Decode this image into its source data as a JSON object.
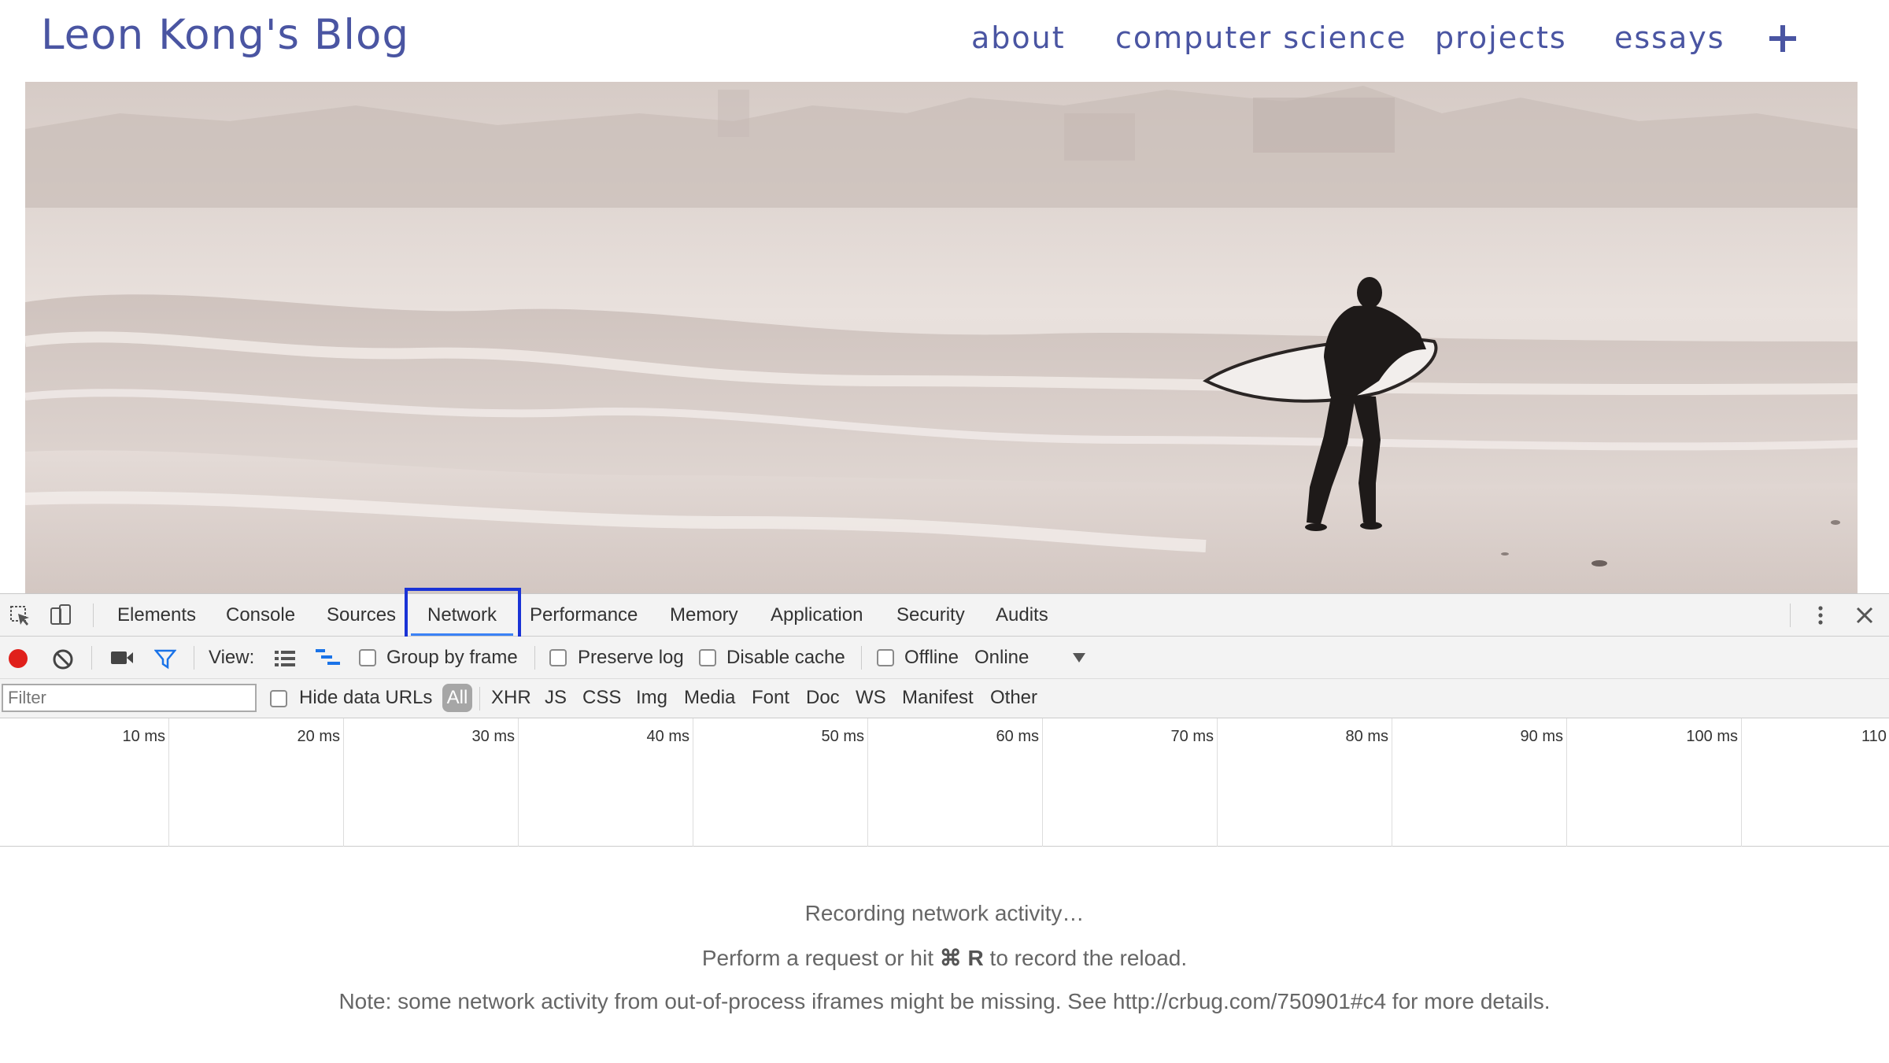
{
  "blog": {
    "title": "Leon Kong's Blog",
    "nav": [
      "about",
      "computer science",
      "projects",
      "essays"
    ],
    "nav_more_icon": "plus-icon",
    "accent_color": "#4a55a2"
  },
  "devtools": {
    "tabs": [
      "Elements",
      "Console",
      "Sources",
      "Network",
      "Performance",
      "Memory",
      "Application",
      "Security",
      "Audits"
    ],
    "active_tab": "Network",
    "highlight_color": "#1a33d6",
    "toolbar": {
      "view_label": "View:",
      "group_by_frame": "Group by frame",
      "preserve_log": "Preserve log",
      "disable_cache": "Disable cache",
      "offline": "Offline",
      "throttling": "Online"
    },
    "filter": {
      "placeholder": "Filter",
      "hide_data_urls": "Hide data URLs",
      "types": [
        "All",
        "XHR",
        "JS",
        "CSS",
        "Img",
        "Media",
        "Font",
        "Doc",
        "WS",
        "Manifest",
        "Other"
      ],
      "active_type": "All"
    },
    "timeline_ticks": [
      "10 ms",
      "20 ms",
      "30 ms",
      "40 ms",
      "50 ms",
      "60 ms",
      "70 ms",
      "80 ms",
      "90 ms",
      "100 ms",
      "110"
    ],
    "messages": {
      "recording": "Recording network activity…",
      "reload_prefix": "Perform a request or hit",
      "reload_shortcut": "⌘ R",
      "reload_suffix": "to record the reload.",
      "note": "Note: some network activity from out-of-process iframes might be missing. See http://crbug.com/750901#c4 for more details."
    },
    "record_color": "#e0201b"
  }
}
